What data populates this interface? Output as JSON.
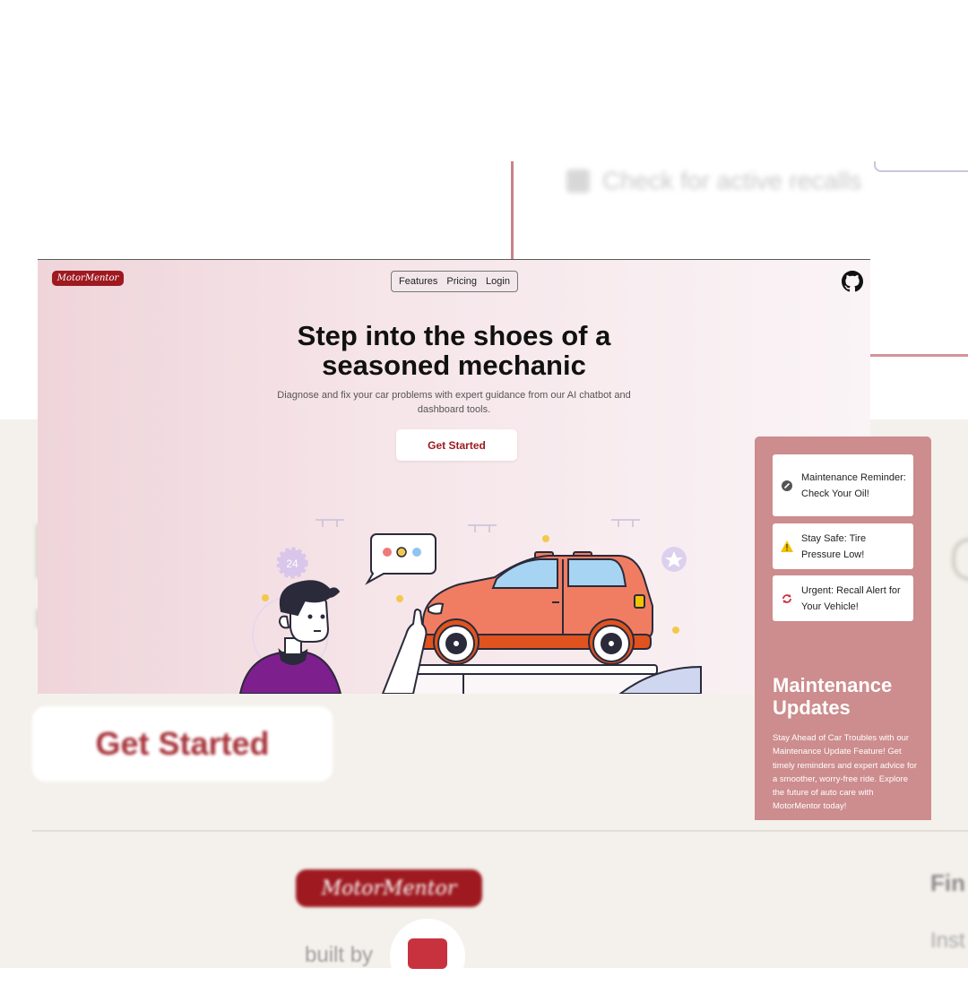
{
  "background": {
    "recall_text": "Check for active recalls",
    "get_started": "Get Started",
    "logo_text": "MotorMentor",
    "built_by": "built by",
    "footer_heading_partial": "Fin",
    "footer_item_partial": "Inst"
  },
  "header": {
    "logo_text": "MotorMentor",
    "nav": [
      "Features",
      "Pricing",
      "Login"
    ],
    "github_icon": "github-icon"
  },
  "hero": {
    "title_line1": "Step into the shoes of a",
    "title_line2": "seasoned mechanic",
    "subtitle_line1": "Diagnose and fix your car problems with expert guidance from our AI chatbot and",
    "subtitle_line2": "dashboard tools.",
    "cta_label": "Get Started"
  },
  "illustration": {
    "badge_text": "24"
  },
  "side_panel": {
    "notifications": [
      {
        "text": "Maintenance Reminder: Check Your Oil!",
        "icon": "wrench-icon"
      },
      {
        "text": "Stay Safe: Tire Pressure Low!",
        "icon": "warning-icon"
      },
      {
        "text": "Urgent: Recall Alert for Your Vehicle!",
        "icon": "recall-icon"
      }
    ],
    "title": "Maintenance Updates",
    "description": "Stay Ahead of Car Troubles with our Maintenance Update Feature! Get timely reminders and expert advice for a smoother, worry-free ride. Explore the future of auto care with MotorMentor today!"
  },
  "colors": {
    "brand": "#9e1a20",
    "panel": "#cd8c8d",
    "car_body": "#f07d62",
    "shirt": "#7e1f8e",
    "warning": "#f2c200"
  }
}
